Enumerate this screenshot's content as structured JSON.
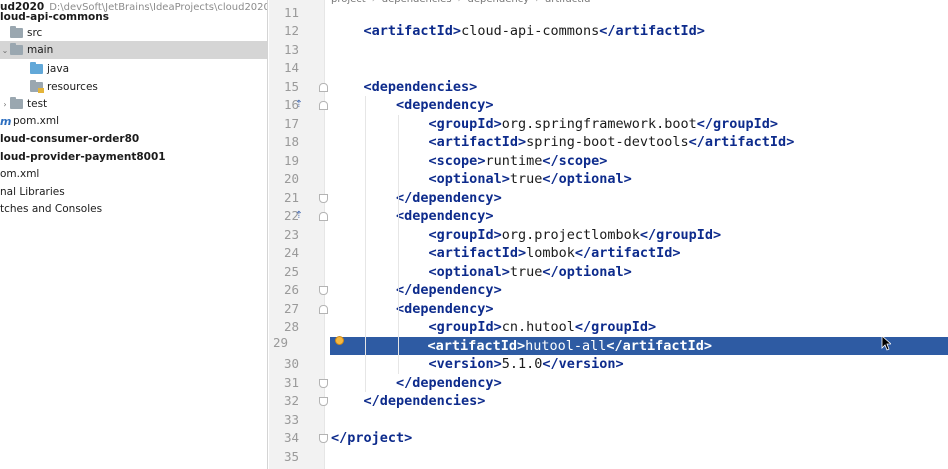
{
  "project_tree": [
    {
      "label": "ud2020",
      "suffix": "D:\\devSoft\\JetBrains\\IdeaProjects\\cloud2020",
      "bold": true,
      "arrow": "",
      "icon": "none",
      "indent": 0
    },
    {
      "label": "loud-api-commons",
      "suffix": "",
      "bold": true,
      "arrow": "",
      "icon": "none",
      "indent": 0
    },
    {
      "label": "src",
      "suffix": "",
      "bold": false,
      "arrow": "",
      "icon": "folder",
      "indent": 1
    },
    {
      "label": "main",
      "suffix": "",
      "bold": false,
      "arrow": "⌄",
      "icon": "folder",
      "indent": 0,
      "selected": true
    },
    {
      "label": "java",
      "suffix": "",
      "bold": false,
      "arrow": "",
      "icon": "folder-blue",
      "indent": 2
    },
    {
      "label": "resources",
      "suffix": "",
      "bold": false,
      "arrow": "",
      "icon": "folder-res",
      "indent": 2
    },
    {
      "label": "test",
      "suffix": "",
      "bold": false,
      "arrow": "›",
      "icon": "folder",
      "indent": 0
    },
    {
      "label": "pom.xml",
      "suffix": "",
      "bold": false,
      "arrow": "",
      "icon": "maven",
      "indent": 0
    },
    {
      "label": "loud-consumer-order80",
      "suffix": "",
      "bold": true,
      "arrow": "",
      "icon": "none",
      "indent": 0
    },
    {
      "label": "loud-provider-payment8001",
      "suffix": "",
      "bold": true,
      "arrow": "",
      "icon": "none",
      "indent": 0
    },
    {
      "label": "om.xml",
      "suffix": "",
      "bold": false,
      "arrow": "",
      "icon": "none",
      "indent": 0
    },
    {
      "label": "nal Libraries",
      "suffix": "",
      "bold": false,
      "arrow": "",
      "icon": "none",
      "indent": 0
    },
    {
      "label": "tches and Consoles",
      "suffix": "",
      "bold": false,
      "arrow": "",
      "icon": "none",
      "indent": 0
    }
  ],
  "breadcrumb": [
    "project",
    "dependencies",
    "dependency",
    "artifactId"
  ],
  "editor": {
    "current_line": "29",
    "lines": [
      {
        "num": "11",
        "tokens": []
      },
      {
        "num": "12",
        "tokens": [
          {
            "t": "    "
          },
          {
            "tag": "<artifactId>"
          },
          {
            "t": "cloud-api-commons"
          },
          {
            "tag": "</artifactId>"
          }
        ]
      },
      {
        "num": "13",
        "tokens": []
      },
      {
        "num": "14",
        "tokens": []
      },
      {
        "num": "15",
        "tokens": [
          {
            "t": "    "
          },
          {
            "tag": "<dependencies>"
          }
        ]
      },
      {
        "num": "16",
        "tokens": [
          {
            "t": "        "
          },
          {
            "tag": "<dependency>"
          }
        ]
      },
      {
        "num": "17",
        "tokens": [
          {
            "t": "            "
          },
          {
            "tag": "<groupId>"
          },
          {
            "t": "org.springframework.boot"
          },
          {
            "tag": "</groupId>"
          }
        ]
      },
      {
        "num": "18",
        "tokens": [
          {
            "t": "            "
          },
          {
            "tag": "<artifactId>"
          },
          {
            "t": "spring-boot-devtools"
          },
          {
            "tag": "</artifactId>"
          }
        ]
      },
      {
        "num": "19",
        "tokens": [
          {
            "t": "            "
          },
          {
            "tag": "<scope>"
          },
          {
            "t": "runtime"
          },
          {
            "tag": "</scope>"
          }
        ]
      },
      {
        "num": "20",
        "tokens": [
          {
            "t": "            "
          },
          {
            "tag": "<optional>"
          },
          {
            "t": "true"
          },
          {
            "tag": "</optional>"
          }
        ]
      },
      {
        "num": "21",
        "tokens": [
          {
            "t": "        "
          },
          {
            "tag": "</dependency>"
          }
        ]
      },
      {
        "num": "22",
        "tokens": [
          {
            "t": "        "
          },
          {
            "tag": "<dependency>"
          }
        ]
      },
      {
        "num": "23",
        "tokens": [
          {
            "t": "            "
          },
          {
            "tag": "<groupId>"
          },
          {
            "t": "org.projectlombok"
          },
          {
            "tag": "</groupId>"
          }
        ]
      },
      {
        "num": "24",
        "tokens": [
          {
            "t": "            "
          },
          {
            "tag": "<artifactId>"
          },
          {
            "t": "lombok"
          },
          {
            "tag": "</artifactId>"
          }
        ]
      },
      {
        "num": "25",
        "tokens": [
          {
            "t": "            "
          },
          {
            "tag": "<optional>"
          },
          {
            "t": "true"
          },
          {
            "tag": "</optional>"
          }
        ]
      },
      {
        "num": "26",
        "tokens": [
          {
            "t": "        "
          },
          {
            "tag": "</dependency>"
          }
        ]
      },
      {
        "num": "27",
        "tokens": [
          {
            "t": "        "
          },
          {
            "tag": "<dependency>"
          }
        ]
      },
      {
        "num": "28",
        "tokens": [
          {
            "t": "            "
          },
          {
            "tag": "<groupId>"
          },
          {
            "t": "cn.hutool"
          },
          {
            "tag": "</groupId>"
          }
        ]
      },
      {
        "num": "29",
        "tokens": [
          {
            "t": "            "
          },
          {
            "tag": "<artifactId>"
          },
          {
            "t": "hutool-all"
          },
          {
            "tag": "</artifactId>"
          }
        ]
      },
      {
        "num": "30",
        "tokens": [
          {
            "t": "            "
          },
          {
            "tag": "<version>"
          },
          {
            "t": "5.1.0"
          },
          {
            "tag": "</version>"
          }
        ]
      },
      {
        "num": "31",
        "tokens": [
          {
            "t": "        "
          },
          {
            "tag": "</dependency>"
          }
        ]
      },
      {
        "num": "32",
        "tokens": [
          {
            "t": "    "
          },
          {
            "tag": "</dependencies>"
          }
        ]
      },
      {
        "num": "33",
        "tokens": []
      },
      {
        "num": "34",
        "tokens": [
          {
            "tag": "</project>"
          }
        ]
      },
      {
        "num": "35",
        "tokens": []
      }
    ]
  },
  "gutter_icons": {
    "line16": "override-icon",
    "line22": "override-icon"
  },
  "colors": {
    "tag": "#0d2b8c",
    "selection": "#2e5ba3",
    "gutter": "#f2f2f2"
  }
}
